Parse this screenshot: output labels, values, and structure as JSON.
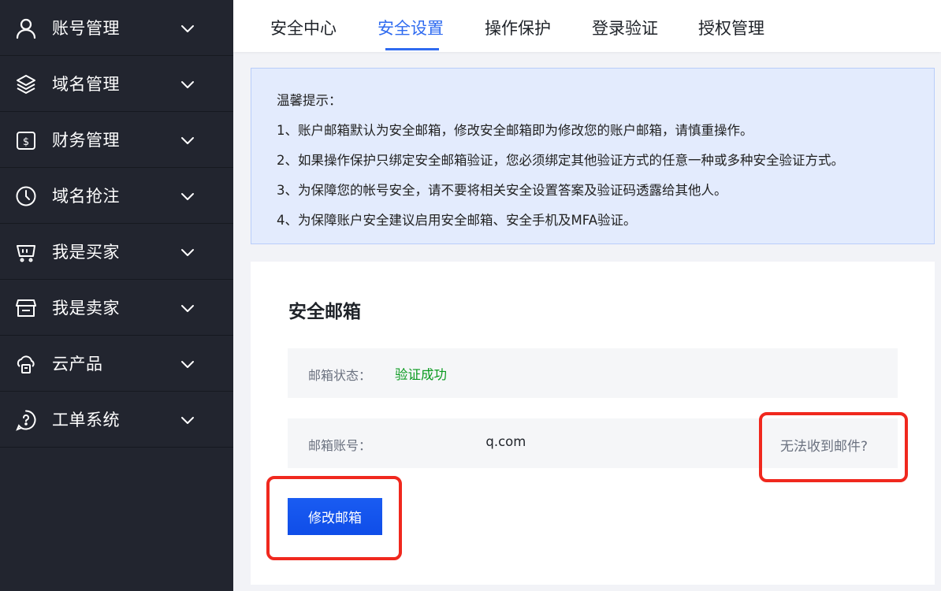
{
  "sidebar": {
    "items": [
      {
        "label": "账号管理",
        "icon": "user-icon"
      },
      {
        "label": "域名管理",
        "icon": "layers-icon"
      },
      {
        "label": "财务管理",
        "icon": "wallet-icon"
      },
      {
        "label": "域名抢注",
        "icon": "clock-icon"
      },
      {
        "label": "我是买家",
        "icon": "cart-icon"
      },
      {
        "label": "我是卖家",
        "icon": "store-icon"
      },
      {
        "label": "云产品",
        "icon": "cloud-icon"
      },
      {
        "label": "工单系统",
        "icon": "help-chat-icon"
      }
    ]
  },
  "tabs": [
    {
      "label": "安全中心"
    },
    {
      "label": "安全设置",
      "active": true
    },
    {
      "label": "操作保护"
    },
    {
      "label": "登录验证"
    },
    {
      "label": "授权管理"
    }
  ],
  "notice": {
    "title": "温馨提示：",
    "lines": [
      "1、账户邮箱默认为安全邮箱，修改安全邮箱即为修改您的账户邮箱，请慎重操作。",
      "2、如果操作保护只绑定安全邮箱验证，您必须绑定其他验证方式的任意一种或多种安全验证方式。",
      "3、为保障您的帐号安全，请不要将相关安全设置答案及验证码透露给其他人。",
      "4、为保障账户安全建议启用安全邮箱、安全手机及MFA验证。"
    ]
  },
  "card": {
    "title": "安全邮箱",
    "status_label": "邮箱状态：",
    "status_value": "验证成功",
    "email_label": "邮箱账号：",
    "email_value": "                      q.com",
    "help_link": "无法收到邮件?",
    "edit_button": "修改邮箱"
  },
  "colors": {
    "sidebar_bg": "#22252f",
    "accent": "#2f6bf0",
    "success": "#0a9a1f",
    "highlight": "#f0281e"
  }
}
